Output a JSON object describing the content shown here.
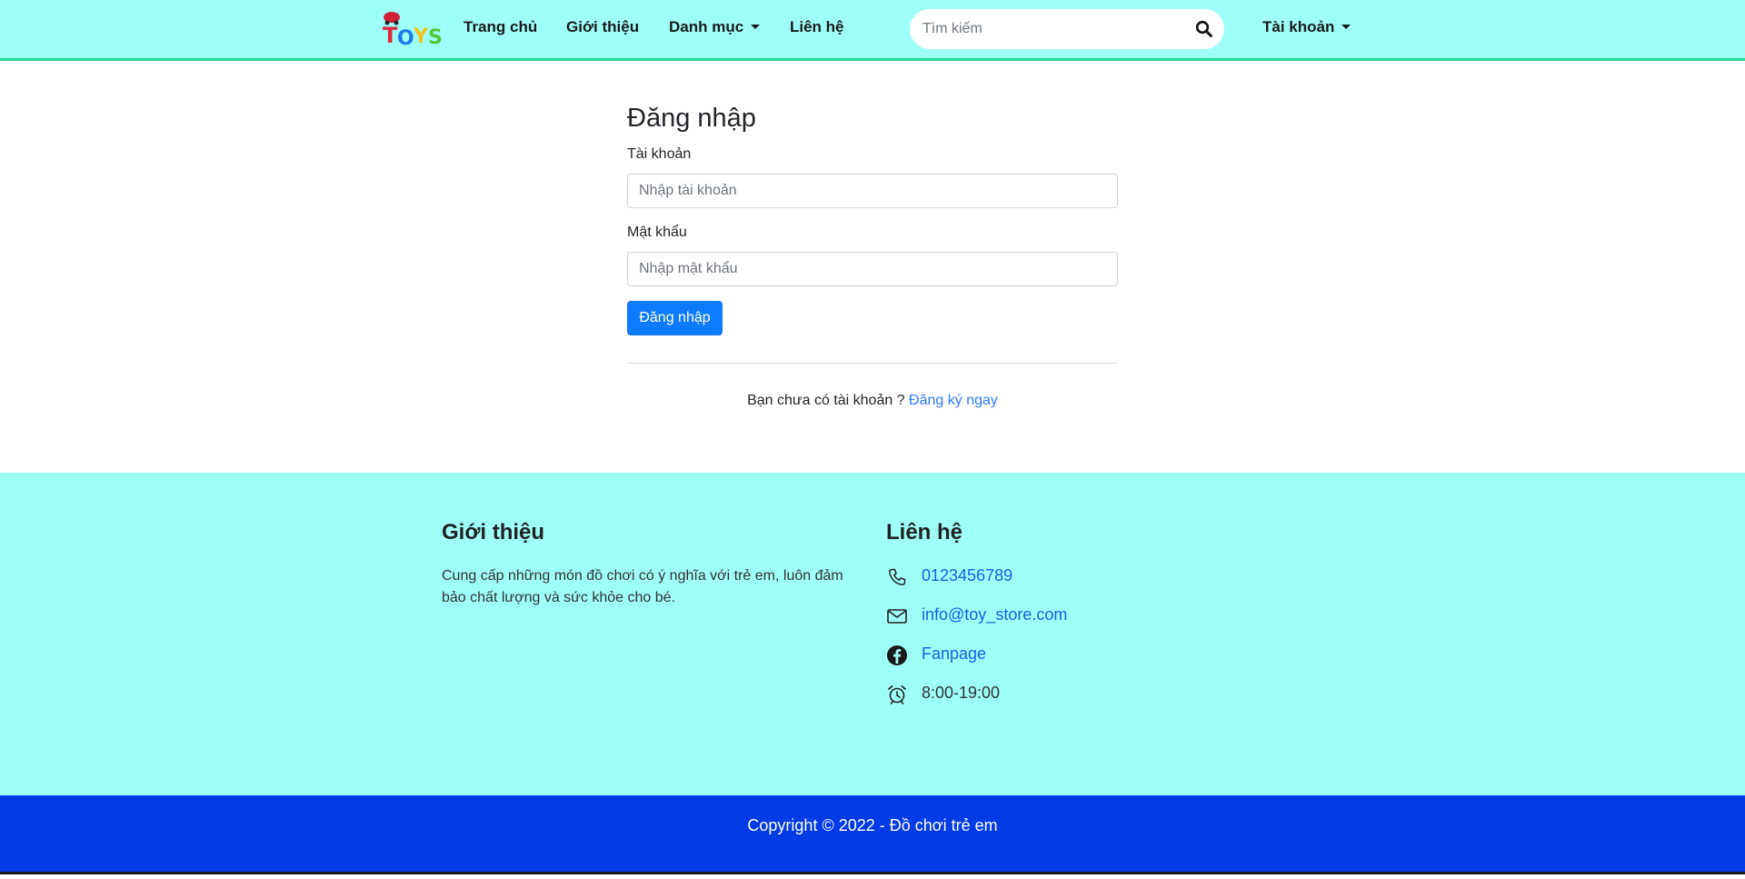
{
  "brand": {
    "logo_text": "TOYS"
  },
  "nav": {
    "home": "Trang chủ",
    "about": "Giới thiệu",
    "categories": "Danh mục",
    "contact": "Liên hệ",
    "account": "Tài khoản"
  },
  "search": {
    "placeholder": "Tìm kiếm"
  },
  "login": {
    "title": "Đăng nhập",
    "username_label": "Tài khoản",
    "username_placeholder": "Nhập tài khoản",
    "password_label": "Mật khẩu",
    "password_placeholder": "Nhập mật khẩu",
    "submit_label": "Đăng nhập",
    "no_account_text": "Bạn chưa có tài khoản ?",
    "register_link": "Đăng ký ngay"
  },
  "footer": {
    "about_heading": "Giới thiệu",
    "about_text": "Cung cấp những món đồ chơi có ý nghĩa với trẻ em, luôn đảm bảo chất lượng và sức khỏe cho bé.",
    "contact_heading": "Liên hệ",
    "phone": "0123456789",
    "email": "info@toy_store.com",
    "fanpage": "Fanpage",
    "hours": "8:00-19:00",
    "copyright": "Copyright © 2022 - Đồ chơi trẻ em"
  },
  "colors": {
    "navbar_bg": "#9efff7",
    "navbar_border": "#25d997",
    "primary_button": "#0d7bff",
    "footer_bg": "#9efff7",
    "copyright_bg": "#003be6",
    "link": "#1760e6"
  },
  "icons": {
    "search": "search-icon",
    "phone": "phone-icon",
    "email": "envelope-icon",
    "facebook": "facebook-icon",
    "hours": "alarm-clock-icon",
    "dropdown": "caret-down-icon"
  }
}
